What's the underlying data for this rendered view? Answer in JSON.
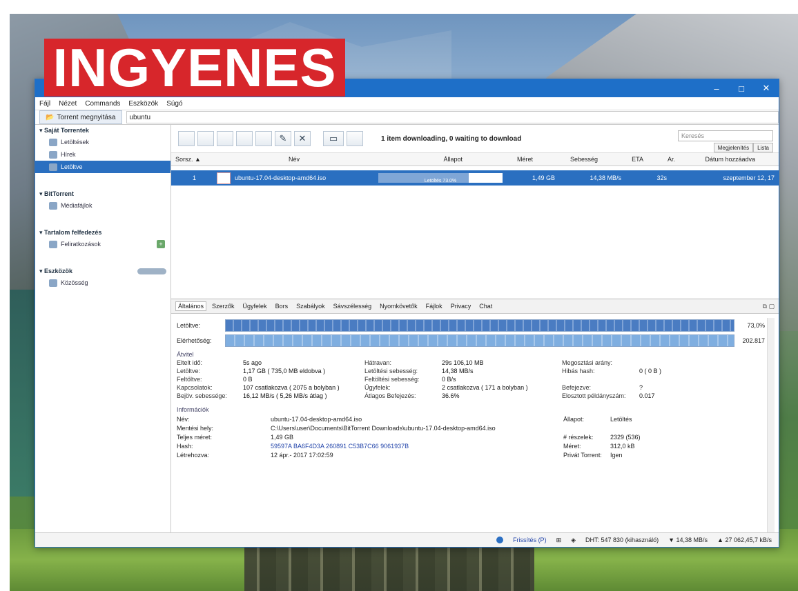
{
  "banner": {
    "text": "INGYENES"
  },
  "window": {
    "controls": [
      "–",
      "□",
      "✕"
    ]
  },
  "menu": [
    "Fájl",
    "Nézet",
    "Commands",
    "Eszközök",
    "Súgó"
  ],
  "address": {
    "tab_label": "Torrent megnyitása",
    "text": "ubuntu"
  },
  "sidebar": {
    "sections": [
      {
        "title": "▾ Saját Torrentek",
        "items": [
          {
            "label": "Letöltések",
            "active": false
          },
          {
            "label": "Hírek",
            "active": false
          },
          {
            "label": "Letöltve",
            "active": true
          }
        ]
      },
      {
        "title": "▾ BitTorrent",
        "items": [
          {
            "label": "Médiafájlok",
            "active": false
          }
        ]
      },
      {
        "title": "▾ Tartalom felfedezés",
        "items": [
          {
            "label": "Feliratkozások",
            "active": false
          }
        ]
      },
      {
        "title": "▾ Eszközök",
        "items": [
          {
            "label": "Közösség",
            "active": false
          }
        ]
      }
    ]
  },
  "toolbar": {
    "status": "1 item downloading, 0 waiting to download",
    "search_placeholder": "Keresés",
    "view_options": [
      "Megjelenítés",
      "Lista"
    ]
  },
  "list": {
    "headers": [
      "Sorsz. ▲",
      "Név",
      "Állapot",
      "Méret",
      "Sebesség",
      "ETA",
      "Ar.",
      "Dátum hozzáadva"
    ],
    "rows": [
      {
        "index": "1",
        "name": "ubuntu-17.04-desktop-amd64.iso",
        "status": "Letöltés 73.0%",
        "progress": 0.73,
        "size": "1,49 GB",
        "speed": "14,38 MB/s",
        "eta": "32s",
        "ratio": "",
        "added": "szeptember 12, 17"
      }
    ]
  },
  "tabs": [
    "Általános",
    "Szerzők",
    "Ügyfelek",
    "Bors",
    "Szabályok",
    "Sávszélesség",
    "Nyomkövetők",
    "Fájlok",
    "Privacy",
    "Chat"
  ],
  "details": {
    "downloaded_label": "Letöltve:",
    "downloaded_pct": "73,0%",
    "downloaded_fraction": 0.73,
    "availability_label": "Elérhetőség:",
    "availability_val": "202.817",
    "transfer_title": "Átvitel",
    "transfer": [
      [
        "Eltelt idő:",
        "5s ago",
        "Hátravan:",
        "29s 106,10 MB",
        "Megosztási arány:",
        ""
      ],
      [
        "Letöltve:",
        "1,17 GB ( 735,0 MB eldobva )",
        "Letöltési sebesség:",
        "14,38 MB/s",
        "Hibás hash:",
        "0 ( 0 B )"
      ],
      [
        "Feltöltve:",
        "0 B",
        "Feltöltési sebesség:",
        "0 B/s",
        "",
        ""
      ],
      [
        "Kapcsolatok:",
        "107 csatlakozva ( 2075 a bolyban )",
        "Ügyfelek:",
        "2 csatlakozva ( 171 a bolyban )",
        "Befejezve:",
        "?"
      ],
      [
        "Bejöv. sebessége:",
        "16,12 MB/s ( 5,26 MB/s átlag )",
        "Átlagos Befejezés:",
        "36.6%",
        "Elosztott példányszám:",
        "0.017"
      ]
    ],
    "info_title": "Információk",
    "info": [
      [
        "Név:",
        "ubuntu-17.04-desktop-amd64.iso",
        "Állapot:",
        "Letöltés"
      ],
      [
        "Mentési hely:",
        "C:\\Users\\user\\Documents\\BitTorrent Downloads\\ubuntu-17.04-desktop-amd64.iso",
        "",
        ""
      ],
      [
        "Teljes méret:",
        "1,49 GB",
        "# részelek:",
        "2329 (536)"
      ],
      [
        "Hash:",
        "59597A BA6F4D3A 260891 C53B7C66 9061937B",
        "Méret:",
        "312,0 kB"
      ],
      [
        "Létrehozva:",
        "12 ápr.- 2017 17:02:59",
        "Privát Torrent:",
        "Igen"
      ]
    ]
  },
  "statusbar": {
    "upgrade": "Frissítés (P)",
    "dht": "DHT: 547 830 (kihasználó)",
    "down": "▼ 14,38 MB/s",
    "up": "▲ 27 062,45,7 kB/s"
  }
}
